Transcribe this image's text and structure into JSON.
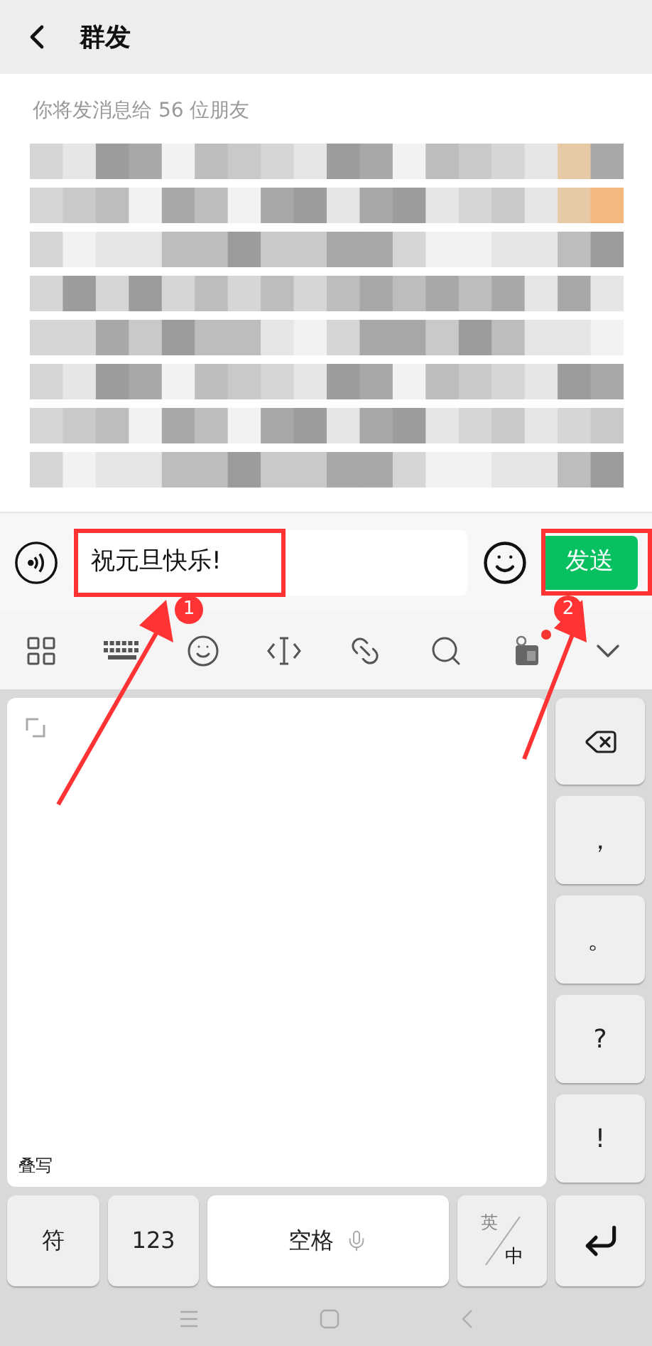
{
  "header": {
    "title": "群发"
  },
  "recipients": {
    "note": "你将发消息给 56 位朋友"
  },
  "composer": {
    "value": "祝元旦快乐!",
    "send_label": "发送"
  },
  "toolbar": [
    {
      "kind": "grid",
      "dot": false
    },
    {
      "kind": "keyboard",
      "dot": false
    },
    {
      "kind": "emoji",
      "dot": false
    },
    {
      "kind": "cursor",
      "dot": false
    },
    {
      "kind": "link",
      "dot": false
    },
    {
      "kind": "search",
      "dot": false
    },
    {
      "kind": "sticker",
      "dot": true
    },
    {
      "kind": "collapse",
      "dot": false
    }
  ],
  "keyboard": {
    "pad_label": "叠写",
    "side_keys": [
      "，",
      "。",
      "?",
      "!"
    ],
    "bottom_keys": [
      {
        "kind": "text",
        "label": "符"
      },
      {
        "kind": "text",
        "label": "123"
      },
      {
        "kind": "space",
        "label": "空格"
      },
      {
        "kind": "lang",
        "top": "英",
        "bottom": "中"
      }
    ]
  },
  "annotations": [
    {
      "label": "1"
    },
    {
      "label": "2"
    }
  ]
}
